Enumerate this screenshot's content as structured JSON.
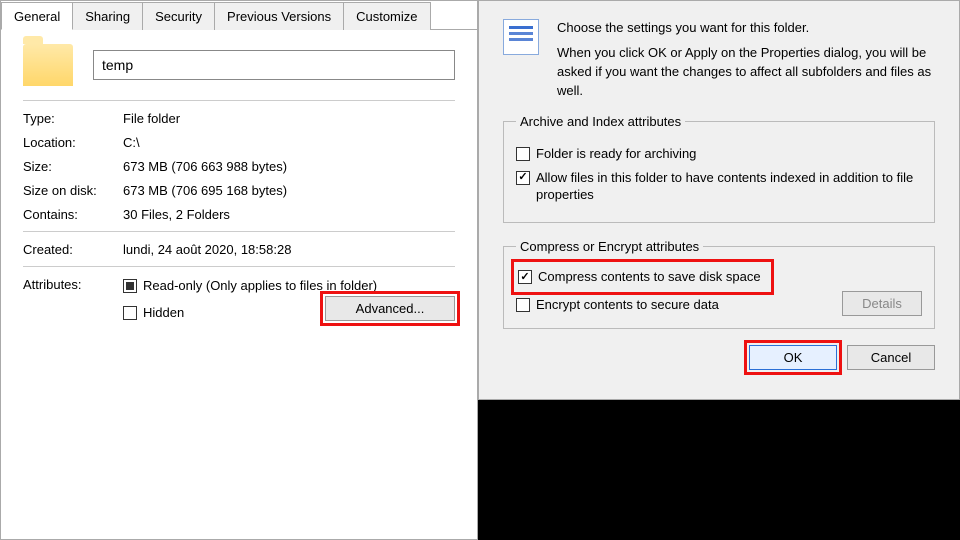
{
  "props": {
    "tabs": [
      "General",
      "Sharing",
      "Security",
      "Previous Versions",
      "Customize"
    ],
    "active_tab": 0,
    "folder_name": "temp",
    "rows": {
      "type_k": "Type:",
      "type_v": "File folder",
      "loc_k": "Location:",
      "loc_v": "C:\\",
      "size_k": "Size:",
      "size_v": "673 MB (706 663 988 bytes)",
      "sod_k": "Size on disk:",
      "sod_v": "673 MB (706 695 168 bytes)",
      "cont_k": "Contains:",
      "cont_v": "30 Files, 2 Folders",
      "created_k": "Created:",
      "created_v": "lundi, 24 août 2020, 18:58:28",
      "attr_k": "Attributes:"
    },
    "readonly_label": "Read-only (Only applies to files in folder)",
    "hidden_label": "Hidden",
    "advanced_btn": "Advanced..."
  },
  "adv": {
    "hdr_line1": "Choose the settings you want for this folder.",
    "hdr_line2": "When you click OK or Apply on the Properties dialog, you will be asked if you want the changes to affect all subfolders and files as well.",
    "group1_legend": "Archive and Index attributes",
    "archive_label": "Folder is ready for archiving",
    "index_label": "Allow files in this folder to have contents indexed in addition to file properties",
    "group2_legend": "Compress or Encrypt attributes",
    "compress_label": "Compress contents to save disk space",
    "encrypt_label": "Encrypt contents to secure data",
    "details_btn": "Details",
    "ok_btn": "OK",
    "cancel_btn": "Cancel"
  }
}
